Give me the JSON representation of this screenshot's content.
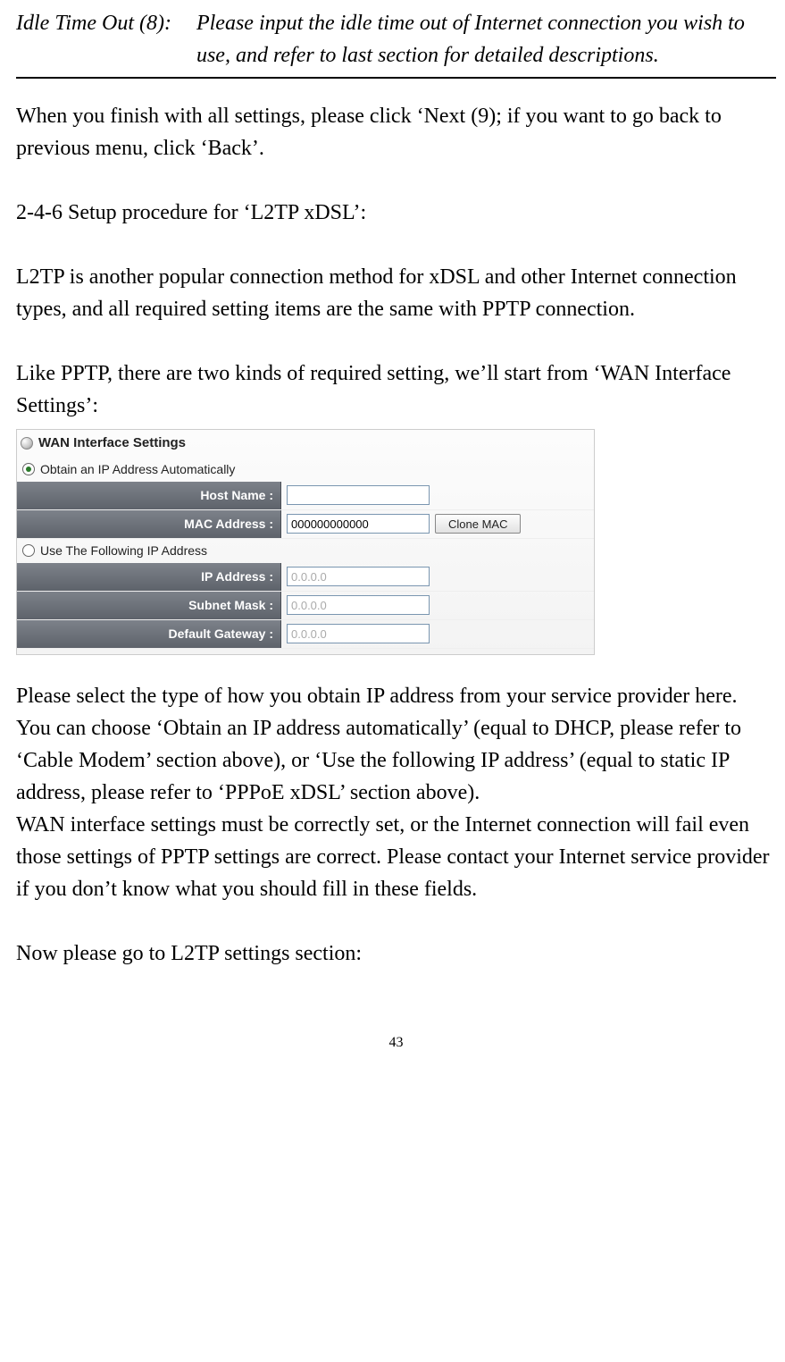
{
  "topRow": {
    "label": "Idle Time Out (8):",
    "desc": "Please input the idle time out of Internet connection you wish to use, and refer to last section for detailed descriptions."
  },
  "para1": "When you finish with all settings, please click ‘Next (9); if you want to go back to previous menu, click ‘Back’.",
  "heading": "2-4-6 Setup procedure for ‘L2TP xDSL’:",
  "para2": "L2TP is another popular connection method for xDSL and other Internet connection types, and all required setting items are the same with PPTP connection.",
  "para3": "Like PPTP, there are two kinds of required setting, we’ll start from ‘WAN Interface Settings’:",
  "panel": {
    "title": "WAN Interface Settings",
    "radioAuto": "Obtain an IP Address Automatically",
    "radioStatic": "Use The Following IP Address",
    "labels": {
      "hostName": "Host Name :",
      "macAddress": "MAC Address :",
      "ipAddress": "IP Address :",
      "subnetMask": "Subnet Mask :",
      "defaultGateway": "Default Gateway :"
    },
    "values": {
      "hostName": "",
      "macAddress": "000000000000",
      "ipAddress": "0.0.0.0",
      "subnetMask": "0.0.0.0",
      "defaultGateway": "0.0.0.0"
    },
    "cloneMacBtn": "Clone MAC"
  },
  "para4": "Please select the type of how you obtain IP address from your service provider here. You can choose ‘Obtain an IP address automatically’ (equal to DHCP, please refer to ‘Cable Modem’ section above), or ‘Use the following IP address’ (equal to static IP address, please refer to ‘PPPoE xDSL’ section above).",
  "para5": "WAN interface settings must be correctly set, or the Internet connection will fail even those settings of PPTP settings are correct. Please contact your Internet service provider if you don’t know what you should fill in these fields.",
  "para6": "Now please go to L2TP settings section:",
  "pageNumber": "43"
}
